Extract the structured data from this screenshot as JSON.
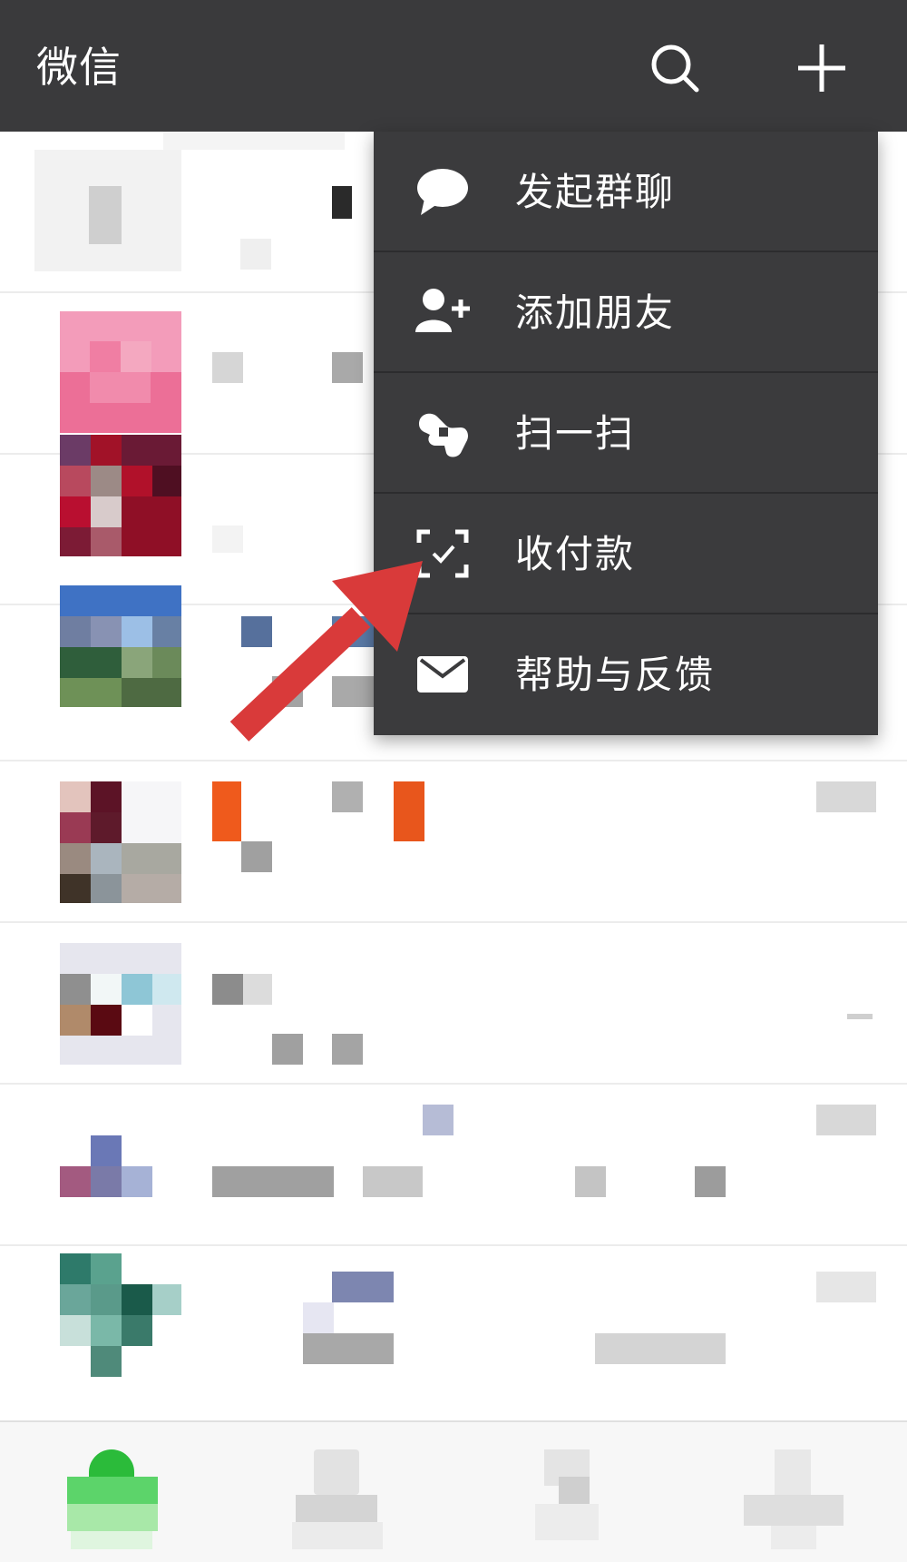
{
  "header": {
    "title": "微信",
    "search_icon": "search-icon",
    "add_icon": "plus-icon",
    "bg_color": "#3a3a3c"
  },
  "menu": {
    "bg_color": "#3b3b3d",
    "items": [
      {
        "label": "发起群聊",
        "icon": "chat-bubble-icon"
      },
      {
        "label": "添加朋友",
        "icon": "add-friend-icon"
      },
      {
        "label": "扫一扫",
        "icon": "scan-icon"
      },
      {
        "label": "收付款",
        "icon": "payment-icon"
      },
      {
        "label": "帮助与反馈",
        "icon": "mail-icon"
      }
    ]
  },
  "annotation": {
    "arrow_color": "#d93a3a",
    "points_to": "收付款"
  },
  "tabbar": {
    "tabs": [
      {
        "icon": "chats-tab-icon",
        "active_color": "#2bbb3a"
      },
      {
        "icon": "contacts-tab-icon"
      },
      {
        "icon": "discover-tab-icon"
      },
      {
        "icon": "me-tab-icon"
      }
    ]
  }
}
